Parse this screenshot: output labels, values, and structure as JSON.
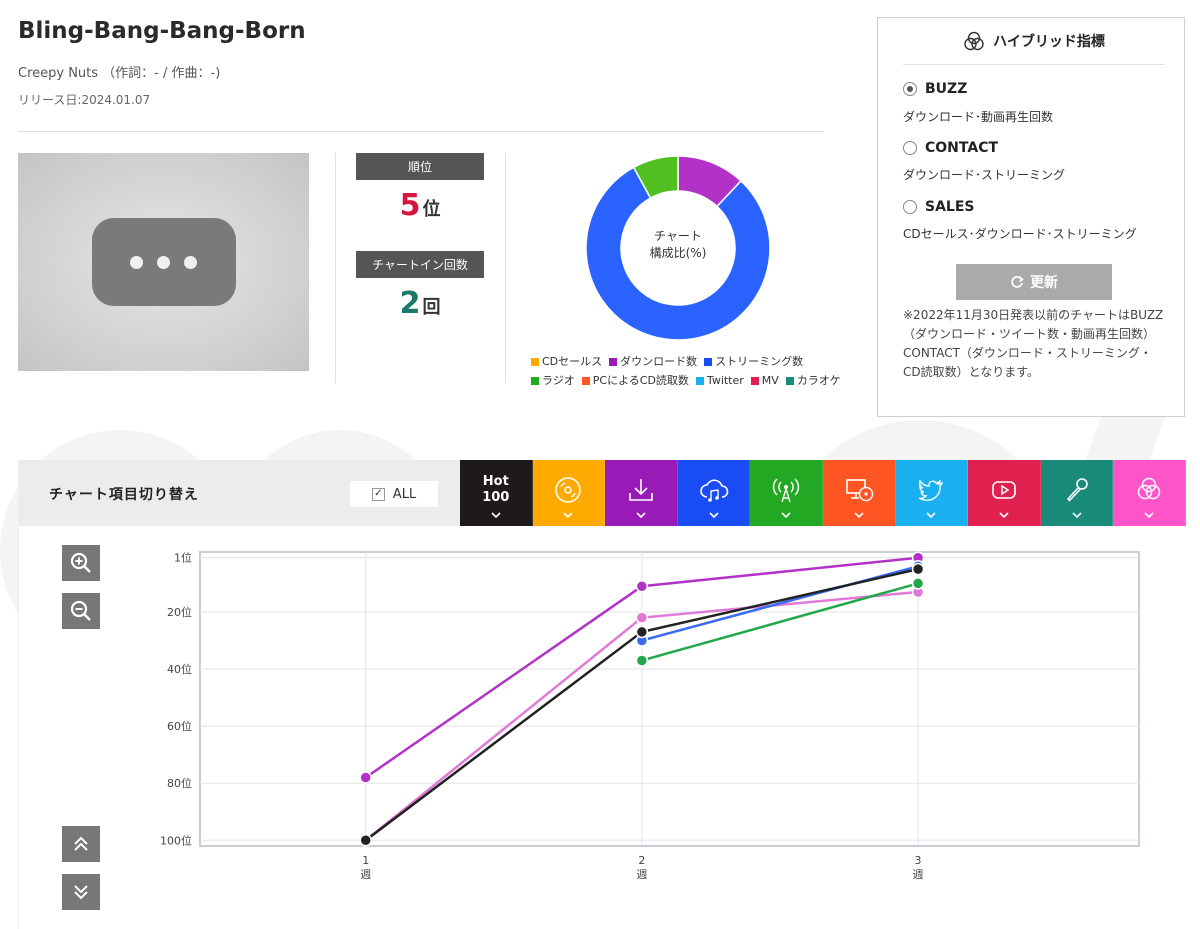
{
  "song": {
    "title": "Bling-Bang-Bang-Born",
    "credit": "Creepy Nuts （作詞：- / 作曲：-)",
    "release": "リリース日:2024.01.07"
  },
  "video": {
    "icon": "ellipsis-play-icon"
  },
  "stats": {
    "rank_label": "順位",
    "rank_value": "5",
    "rank_unit": "位",
    "count_label": "チャートイン回数",
    "count_value": "2",
    "count_unit": "回"
  },
  "donut": {
    "center_line1": "チャート",
    "center_line2": "構成比(%)",
    "slices": [
      {
        "name": "ダウンロード数",
        "value": 12,
        "color": "#b232c8"
      },
      {
        "name": "ストリーミング数",
        "value": 80,
        "color": "#2a63ff"
      },
      {
        "name": "ラジオ",
        "value": 8,
        "color": "#50c020"
      }
    ],
    "legend_row1": [
      {
        "label": "CDセールス",
        "color": "#ffaa00"
      },
      {
        "label": "ダウンロード数",
        "color": "#9a1ab8"
      },
      {
        "label": "ストリーミング数",
        "color": "#1a4cf5"
      }
    ],
    "legend_row2": [
      {
        "label": "ラジオ",
        "color": "#22a822"
      },
      {
        "label": "PCによるCD読取数",
        "color": "#ff5522"
      },
      {
        "label": "Twitter",
        "color": "#1ab0f0"
      },
      {
        "label": "MV",
        "color": "#e0204e"
      },
      {
        "label": "カラオケ",
        "color": "#1a8a7a"
      }
    ]
  },
  "hybrid": {
    "title": "ハイブリッド指標",
    "icon": "triple-circle-icon",
    "options": [
      {
        "label": "BUZZ",
        "desc": "ダウンロード･動画再生回数",
        "selected": true
      },
      {
        "label": "CONTACT",
        "desc": "ダウンロード･ストリーミング",
        "selected": false
      },
      {
        "label": "SALES",
        "desc": "CDセールス･ダウンロード･ストリーミング",
        "selected": false
      }
    ],
    "update_label": "更新",
    "note": "※2022年11月30日発表以前のチャートはBUZZ（ダウンロード・ツイート数・動画再生回数）CONTACT（ダウンロード・ストリーミング・CD読取数）となります。"
  },
  "switcher": {
    "label": "チャート項目切り替え",
    "all_label": "ALL",
    "hot_line1": "Hot",
    "hot_line2": "100",
    "tabs": [
      {
        "name": "hot100",
        "color": "#1e1a1a",
        "icon": "hot100-text"
      },
      {
        "name": "cd-sales",
        "color": "#ffaa00",
        "icon": "cd-icon"
      },
      {
        "name": "download",
        "color": "#9a1ab8",
        "icon": "download-icon"
      },
      {
        "name": "streaming",
        "color": "#1a4cf5",
        "icon": "cloud-music-icon"
      },
      {
        "name": "radio",
        "color": "#22a822",
        "icon": "radio-tower-icon"
      },
      {
        "name": "pc-cd-read",
        "color": "#ff5522",
        "icon": "pc-cd-icon"
      },
      {
        "name": "twitter",
        "color": "#1ab0f0",
        "icon": "twitter-icon"
      },
      {
        "name": "mv",
        "color": "#e0204e",
        "icon": "youtube-icon"
      },
      {
        "name": "karaoke",
        "color": "#1a8a7a",
        "icon": "microphone-icon"
      },
      {
        "name": "hybrid",
        "color": "#ff55c8",
        "icon": "triple-circle-icon"
      }
    ]
  },
  "controls": {
    "zoom_in": "zoom-in-icon",
    "zoom_out": "zoom-out-icon",
    "scroll_up": "double-chevron-up-icon",
    "scroll_down": "double-chevron-down-icon"
  },
  "chart_data": {
    "type": "line",
    "title": "",
    "xlabel": "",
    "ylabel": "",
    "x": [
      1,
      2,
      3
    ],
    "x_tick_labels": [
      [
        "1",
        "週"
      ],
      [
        "2",
        "週"
      ],
      [
        "3",
        "週"
      ]
    ],
    "y_tick_labels": [
      "1位",
      "20位",
      "40位",
      "60位",
      "80位",
      "100位"
    ],
    "y_ticks": [
      1,
      20,
      40,
      60,
      80,
      100
    ],
    "ylim": [
      102,
      -1
    ],
    "y_inverted": true,
    "grid": true,
    "series": [
      {
        "color": "#b232c8",
        "values": [
          78,
          11,
          1
        ]
      },
      {
        "color": "#e07ad6",
        "values": [
          100,
          22,
          13
        ]
      },
      {
        "color": "#3a6bf0",
        "values": [
          null,
          30,
          4
        ]
      },
      {
        "color": "#22a84a",
        "values": [
          null,
          37,
          10
        ]
      },
      {
        "color": "#222222",
        "values": [
          100,
          27,
          5
        ]
      }
    ]
  }
}
